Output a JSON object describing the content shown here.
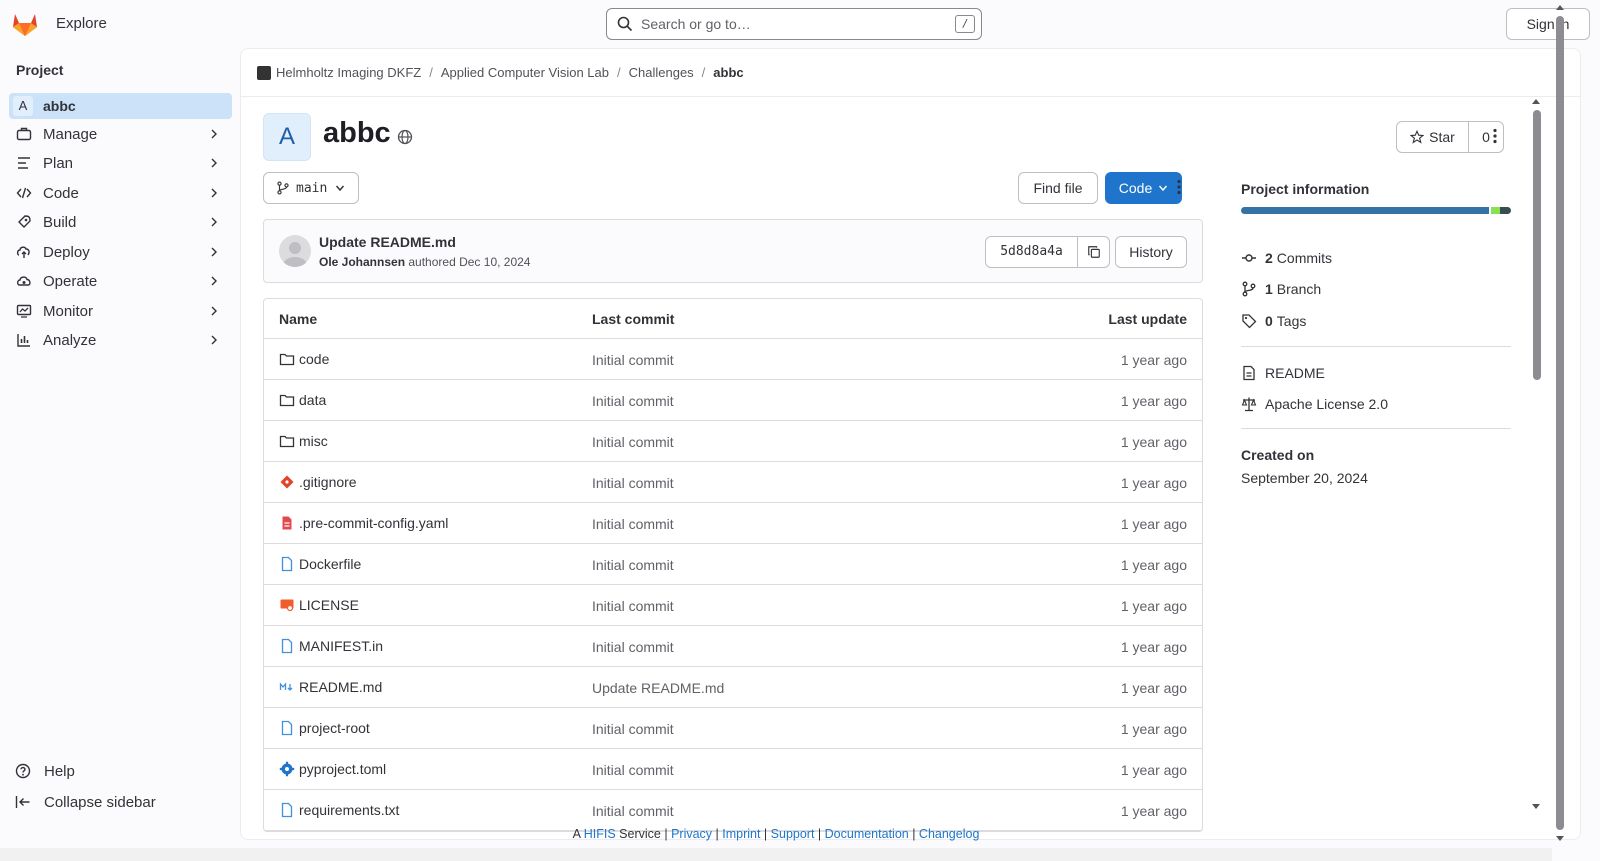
{
  "topbar": {
    "explore_label": "Explore",
    "search_placeholder": "Search or go to…",
    "search_shortcut": "/",
    "signin_label": "Sign in"
  },
  "sidebar": {
    "heading": "Project",
    "project_avatar": "A",
    "project_name": "abbc",
    "items": [
      {
        "label": "Manage",
        "icon": "briefcase-icon"
      },
      {
        "label": "Plan",
        "icon": "planning-icon"
      },
      {
        "label": "Code",
        "icon": "code-icon"
      },
      {
        "label": "Build",
        "icon": "rocket-icon"
      },
      {
        "label": "Deploy",
        "icon": "deploy-icon"
      },
      {
        "label": "Operate",
        "icon": "cloud-gear-icon"
      },
      {
        "label": "Monitor",
        "icon": "monitor-icon"
      },
      {
        "label": "Analyze",
        "icon": "chart-icon"
      }
    ],
    "help_label": "Help",
    "collapse_label": "Collapse sidebar"
  },
  "breadcrumb": [
    "Helmholtz Imaging DKFZ",
    "Applied Computer Vision Lab",
    "Challenges",
    "abbc"
  ],
  "project": {
    "avatar": "A",
    "title": "abbc",
    "star_label": "Star",
    "star_count": "0"
  },
  "repo": {
    "branch": "main",
    "find_file_label": "Find file",
    "code_label": "Code"
  },
  "commit": {
    "title": "Update README.md",
    "author": "Ole Johannsen",
    "authored_text": "authored",
    "date": "Dec 10, 2024",
    "sha": "5d8d8a4a",
    "history_label": "History"
  },
  "table": {
    "headers": [
      "Name",
      "Last commit",
      "Last update"
    ],
    "rows": [
      {
        "name": "code",
        "icon": "folder-icon",
        "commit": "Initial commit",
        "updated": "1 year ago"
      },
      {
        "name": "data",
        "icon": "folder-icon",
        "commit": "Initial commit",
        "updated": "1 year ago"
      },
      {
        "name": "misc",
        "icon": "folder-icon",
        "commit": "Initial commit",
        "updated": "1 year ago"
      },
      {
        "name": ".gitignore",
        "icon": "git-icon",
        "commit": "Initial commit",
        "updated": "1 year ago"
      },
      {
        "name": ".pre-commit-config.yaml",
        "icon": "yaml-icon",
        "commit": "Initial commit",
        "updated": "1 year ago"
      },
      {
        "name": "Dockerfile",
        "icon": "file-icon",
        "commit": "Initial commit",
        "updated": "1 year ago"
      },
      {
        "name": "LICENSE",
        "icon": "license-icon",
        "commit": "Initial commit",
        "updated": "1 year ago"
      },
      {
        "name": "MANIFEST.in",
        "icon": "file-icon",
        "commit": "Initial commit",
        "updated": "1 year ago"
      },
      {
        "name": "README.md",
        "icon": "markdown-icon",
        "commit": "Update README.md",
        "updated": "1 year ago"
      },
      {
        "name": "project-root",
        "icon": "file-icon",
        "commit": "Initial commit",
        "updated": "1 year ago"
      },
      {
        "name": "pyproject.toml",
        "icon": "gear-icon",
        "commit": "Initial commit",
        "updated": "1 year ago"
      },
      {
        "name": "requirements.txt",
        "icon": "file-icon",
        "commit": "Initial commit",
        "updated": "1 year ago"
      }
    ]
  },
  "info": {
    "heading": "Project information",
    "commits_count": "2",
    "commits_label": "Commits",
    "branch_count": "1",
    "branch_label": "Branch",
    "tags_count": "0",
    "tags_label": "Tags",
    "readme_label": "README",
    "license_label": "Apache License 2.0",
    "created_heading": "Created on",
    "created_value": "September 20, 2024",
    "language_bar_colors": [
      "#3572a5",
      "#89e051",
      "#384d54"
    ]
  },
  "footer": {
    "prefix": "A",
    "hifis": "HIFIS",
    "service": "Service",
    "links": [
      "Privacy",
      "Imprint",
      "Support",
      "Documentation",
      "Changelog"
    ]
  },
  "colors": {
    "accent": "#1f75cb",
    "selected": "#cbe2f9"
  }
}
